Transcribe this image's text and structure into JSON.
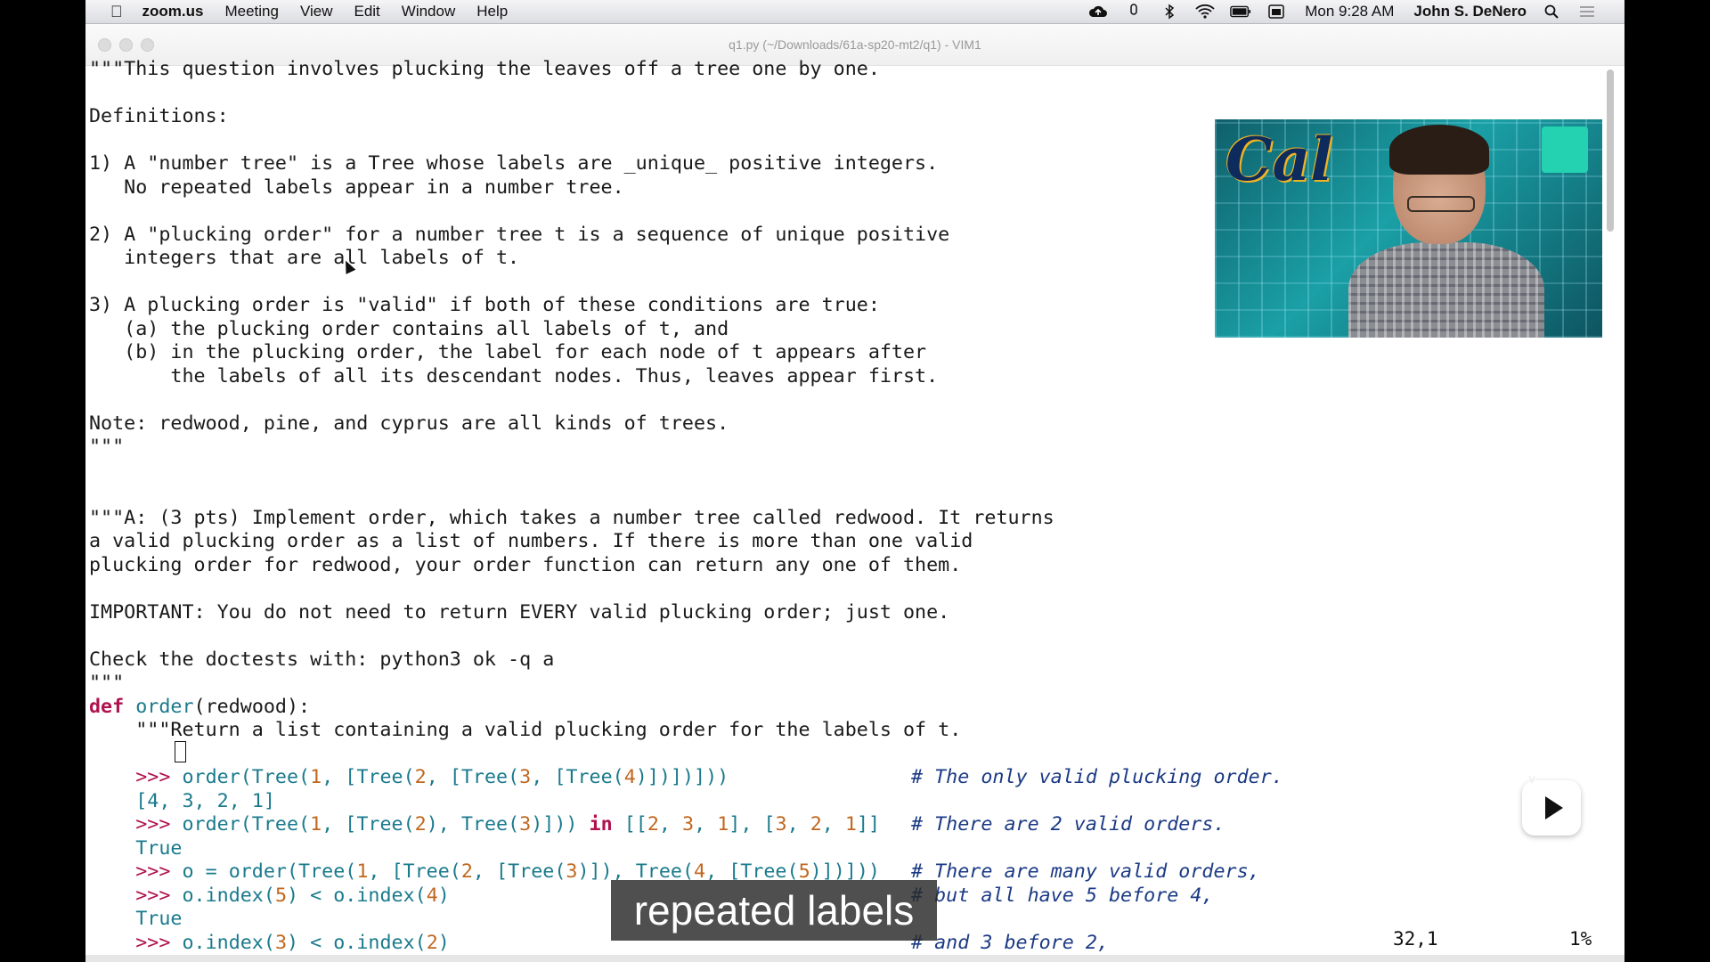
{
  "menubar": {
    "app": "zoom.us",
    "items": [
      "Meeting",
      "View",
      "Edit",
      "Window",
      "Help"
    ],
    "clock": "Mon 9:28 AM",
    "user": "John S. DeNero",
    "icons": [
      "cloud-upload-icon",
      "mic-icon",
      "bluetooth-icon",
      "wifi-icon",
      "battery-icon",
      "calendar-icon",
      "spotlight-search-icon",
      "notification-list-icon"
    ]
  },
  "window": {
    "title": "q1.py (~/Downloads/61a-sp20-mt2/q1) - VIM1"
  },
  "editor": {
    "lines": [
      "\"\"\"This question involves plucking the leaves off a tree one by one.",
      "",
      "Definitions:",
      "",
      "1) A \"number tree\" is a Tree whose labels are _unique_ positive integers.",
      "   No repeated labels appear in a number tree.",
      "",
      "2) A \"plucking order\" for a number tree t is a sequence of unique positive",
      "   integers that are all labels of t.",
      "",
      "3) A plucking order is \"valid\" if both of these conditions are true:",
      "   (a) the plucking order contains all labels of t, and",
      "   (b) in the plucking order, the label for each node of t appears after",
      "       the labels of all its descendant nodes. Thus, leaves appear first.",
      "",
      "Note: redwood, pine, and cyprus are all kinds of trees.",
      "\"\"\"",
      "",
      "",
      "\"\"\"A: (3 pts) Implement order, which takes a number tree called redwood. It returns",
      "a valid plucking order as a list of numbers. If there is more than one valid",
      "plucking order for redwood, your order function can return any one of them.",
      "",
      "IMPORTANT: You do not need to return EVERY valid plucking order; just one.",
      "",
      "Check the doctests with: python3 ok -q a",
      "\"\"\""
    ],
    "def_keyword": "def",
    "def_name": "order",
    "def_rest": "(redwood):",
    "docstring": "    \"\"\"Return a list containing a valid plucking order for the labels of t.",
    "doctests": [
      {
        "prompt": ">>>",
        "code": "order(Tree(1, [Tree(2, [Tree(3, [Tree(4)])])]))",
        "comment": "# The only valid plucking order."
      },
      {
        "output": "[4, 3, 2, 1]"
      },
      {
        "prompt": ">>>",
        "code": "order(Tree(1, [Tree(2), Tree(3)])) in [[2, 3, 1], [3, 2, 1]]",
        "comment": "# There are 2 valid orders."
      },
      {
        "output": "True"
      },
      {
        "prompt": ">>>",
        "code": "o = order(Tree(1, [Tree(2, [Tree(3)]), Tree(4, [Tree(5)])]))",
        "comment": "# There are many valid orders,"
      },
      {
        "prompt": ">>>",
        "code": "o.index(5) < o.index(4)",
        "comment": "# but all have 5 before 4,"
      },
      {
        "output": "True"
      },
      {
        "prompt": ">>>",
        "code": "o.index(3) < o.index(2)",
        "comment": "# and 3 before 2,"
      }
    ],
    "status_position": "32,1",
    "status_percent": "1%"
  },
  "video": {
    "logo_text": "Cal"
  },
  "caption": "repeated labels"
}
